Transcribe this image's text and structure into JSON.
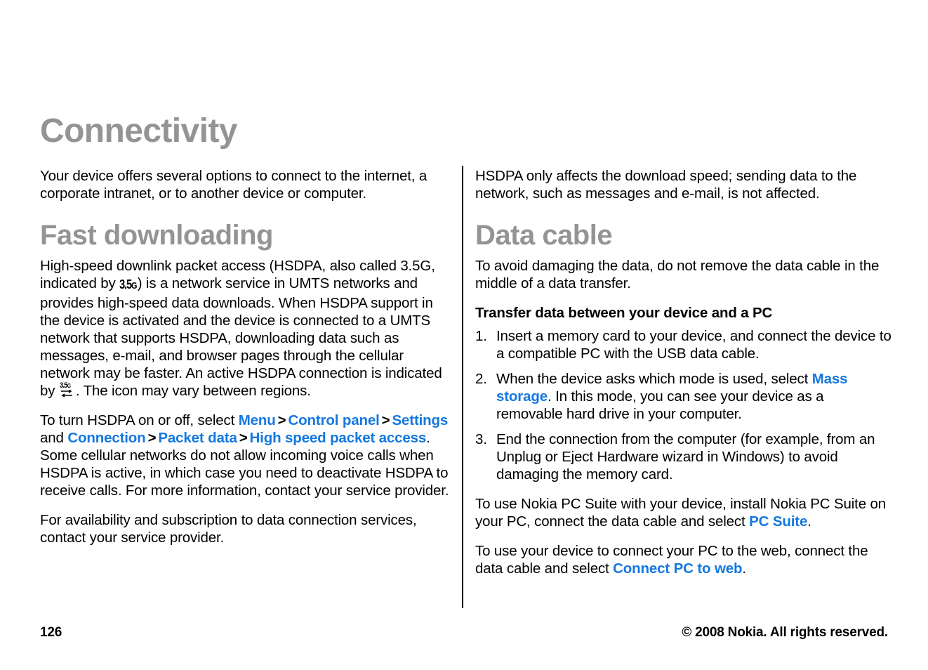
{
  "document": {
    "title": "Connectivity",
    "page_number": "126",
    "copyright": "© 2008 Nokia. All rights reserved.",
    "heading_color": "#949494",
    "link_color": "#1478e0",
    "text_color": "#000000"
  },
  "left_column": {
    "intro": "Your device offers several options to connect to the internet, a corporate intranet, or to another device or computer.",
    "section_heading": "Fast downloading",
    "para1_a": "High-speed downlink packet access (HSDPA, also called 3.5G, indicated by ",
    "para1_icon": "3.5G",
    "para1_b": ") is a network service in UMTS networks and provides high-speed data downloads. When HSDPA support in the device is activated and the device is connected to a UMTS network that supports HSDPA, downloading data such as messages, e-mail, and browser pages through the cellular network may be faster. An active HSDPA connection is indicated by ",
    "para1_icon2": "3.5G",
    "para1_c": ". The icon may vary between regions.",
    "para2_a": "To turn HSDPA on or off, select ",
    "links": {
      "menu": "Menu",
      "control_panel": "Control panel",
      "settings": "Settings",
      "connection": "Connection",
      "packet_data": "Packet data",
      "high_speed_packet_access": "High speed packet access"
    },
    "sep": ">",
    "para2_and": " and ",
    "para2_b": ". Some cellular networks do not allow incoming voice calls when HSDPA is active, in which case you need to deactivate HSDPA to receive calls. For more information, contact your service provider.",
    "para3": "For availability and subscription to data connection services, contact your service provider."
  },
  "right_column": {
    "intro": "HSDPA only affects the download speed; sending data to the network, such as messages and e-mail, is not affected.",
    "section_heading": "Data cable",
    "para1": "To avoid damaging the data, do not remove the data cable in the middle of a data transfer.",
    "subsection_heading": "Transfer data between your device and a PC",
    "steps": [
      {
        "num": "1.",
        "text_a": "Insert a memory card to your device, and connect the device to a compatible PC with the USB data cable.",
        "link": "",
        "text_b": ""
      },
      {
        "num": "2.",
        "text_a": "When the device asks which mode is used, select ",
        "link": "Mass storage",
        "text_b": ". In this mode, you can see your device as a removable hard drive in your computer."
      },
      {
        "num": "3.",
        "text_a": "End the connection from the computer (for example, from an Unplug or Eject Hardware wizard in Windows) to avoid damaging the memory card.",
        "link": "",
        "text_b": ""
      }
    ],
    "para2_a": "To use Nokia PC Suite with your device, install Nokia PC Suite on your PC, connect the data cable and select ",
    "para2_link": "PC Suite",
    "para2_b": ".",
    "para3_a": "To use your device to connect your PC to the web, connect the data cable and select ",
    "para3_link": "Connect PC to web",
    "para3_b": "."
  }
}
